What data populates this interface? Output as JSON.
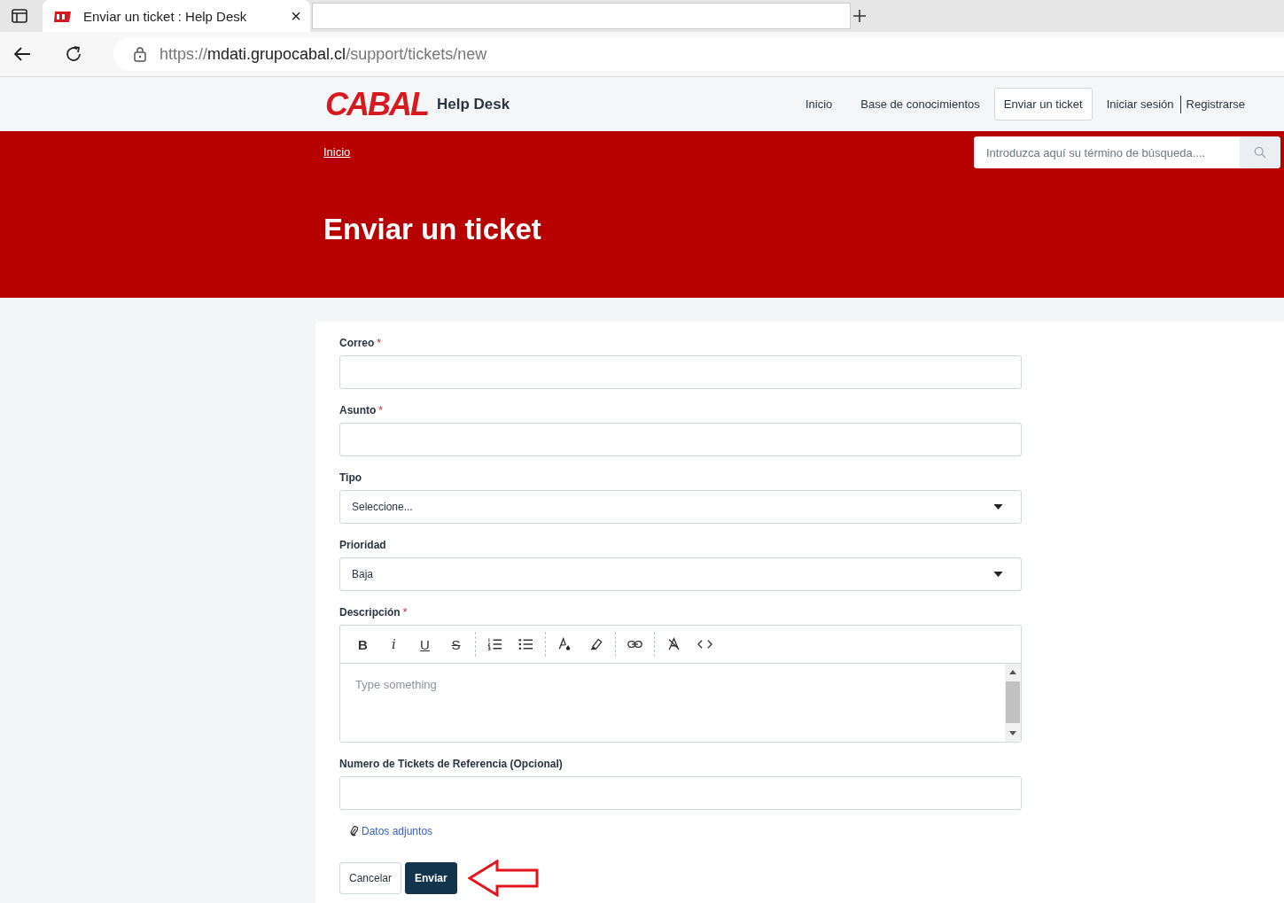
{
  "browser": {
    "tab": {
      "title": "Enviar un ticket : Help Desk",
      "close": "×"
    },
    "url": {
      "host": "mdati.grupocabal.cl",
      "scheme": "https://",
      "path": "/support/tickets/new"
    }
  },
  "header": {
    "logo": "CABAL",
    "brand": "Help Desk",
    "nav": [
      {
        "label": "Inicio",
        "selected": false
      },
      {
        "label": "Base de conocimientos",
        "selected": false
      },
      {
        "label": "Enviar un ticket",
        "selected": true
      },
      {
        "label": "Iniciar sesión",
        "selected": false
      },
      {
        "label": "Registrarse",
        "selected": false
      }
    ]
  },
  "banner": {
    "breadcrumb": "Inicio",
    "search": {
      "placeholder": "Introduzca aquí su término de búsqueda...."
    },
    "title": "Enviar un ticket"
  },
  "form": {
    "fields": [
      {
        "kind": "text",
        "label": "Correo",
        "marker": "*"
      },
      {
        "kind": "text",
        "label": "Asunto",
        "marker": "*"
      },
      {
        "kind": "select",
        "label": "Tipo",
        "value": "Seleccione..."
      },
      {
        "kind": "select",
        "label": "Prioridad",
        "value": "Baja"
      },
      {
        "kind": "editor",
        "label": "Descripción",
        "marker": "*",
        "placeholder": "Type something",
        "toolbar": [
          [
            {
              "kind": "bold",
              "text": "B"
            },
            {
              "kind": "italic",
              "text": "i"
            },
            {
              "kind": "underline",
              "text": "U"
            },
            {
              "kind": "strike",
              "text": "S"
            }
          ],
          [
            {
              "kind": "ordered-list"
            },
            {
              "kind": "bullet-list"
            }
          ],
          [
            {
              "kind": "text-color"
            },
            {
              "kind": "highlight"
            }
          ],
          [
            {
              "kind": "link"
            }
          ],
          [
            {
              "kind": "clear-format"
            },
            {
              "kind": "code"
            }
          ]
        ]
      },
      {
        "kind": "text",
        "label": "Numero de Tickets de Referencia (Opcional)"
      }
    ],
    "attachments": "Datos adjuntos",
    "buttons": [
      {
        "kind": "secondary",
        "label": "Cancelar"
      },
      {
        "kind": "primary",
        "label": "Enviar"
      }
    ]
  }
}
